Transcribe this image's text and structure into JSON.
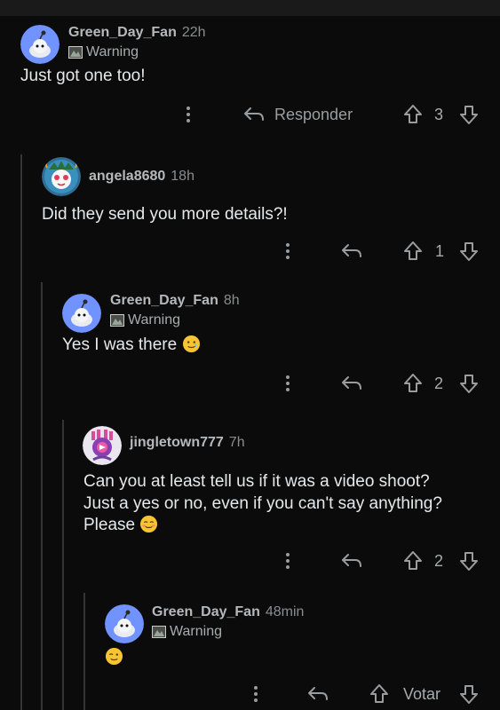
{
  "comments": [
    {
      "username": "Green_Day_Fan",
      "age": "22h",
      "flair": "Warning",
      "text": "Just got one too!",
      "reply_label": "Responder",
      "score": "3"
    },
    {
      "username": "angela8680",
      "age": "18h",
      "text": "Did they send you more details?!",
      "score": "1"
    },
    {
      "username": "Green_Day_Fan",
      "age": "8h",
      "flair": "Warning",
      "text": "Yes I was there",
      "score": "2"
    },
    {
      "username": "jingletown777",
      "age": "7h",
      "text_lines": [
        "Can you at least tell us if it was a video shoot?",
        "Just a yes or no, even if you can't say anything?",
        "Please"
      ],
      "score": "2"
    },
    {
      "username": "Green_Day_Fan",
      "age": "48min",
      "flair": "Warning",
      "text": "",
      "score_label": "Votar"
    }
  ],
  "icons": {
    "more": "more-vertical-icon",
    "reply": "reply-arrow-icon",
    "upvote": "upvote-arrow-icon",
    "downvote": "downvote-arrow-icon"
  },
  "colors": {
    "background": "#0b0b0b",
    "thread_line": "#343536",
    "default_avatar": "#7193ff"
  }
}
